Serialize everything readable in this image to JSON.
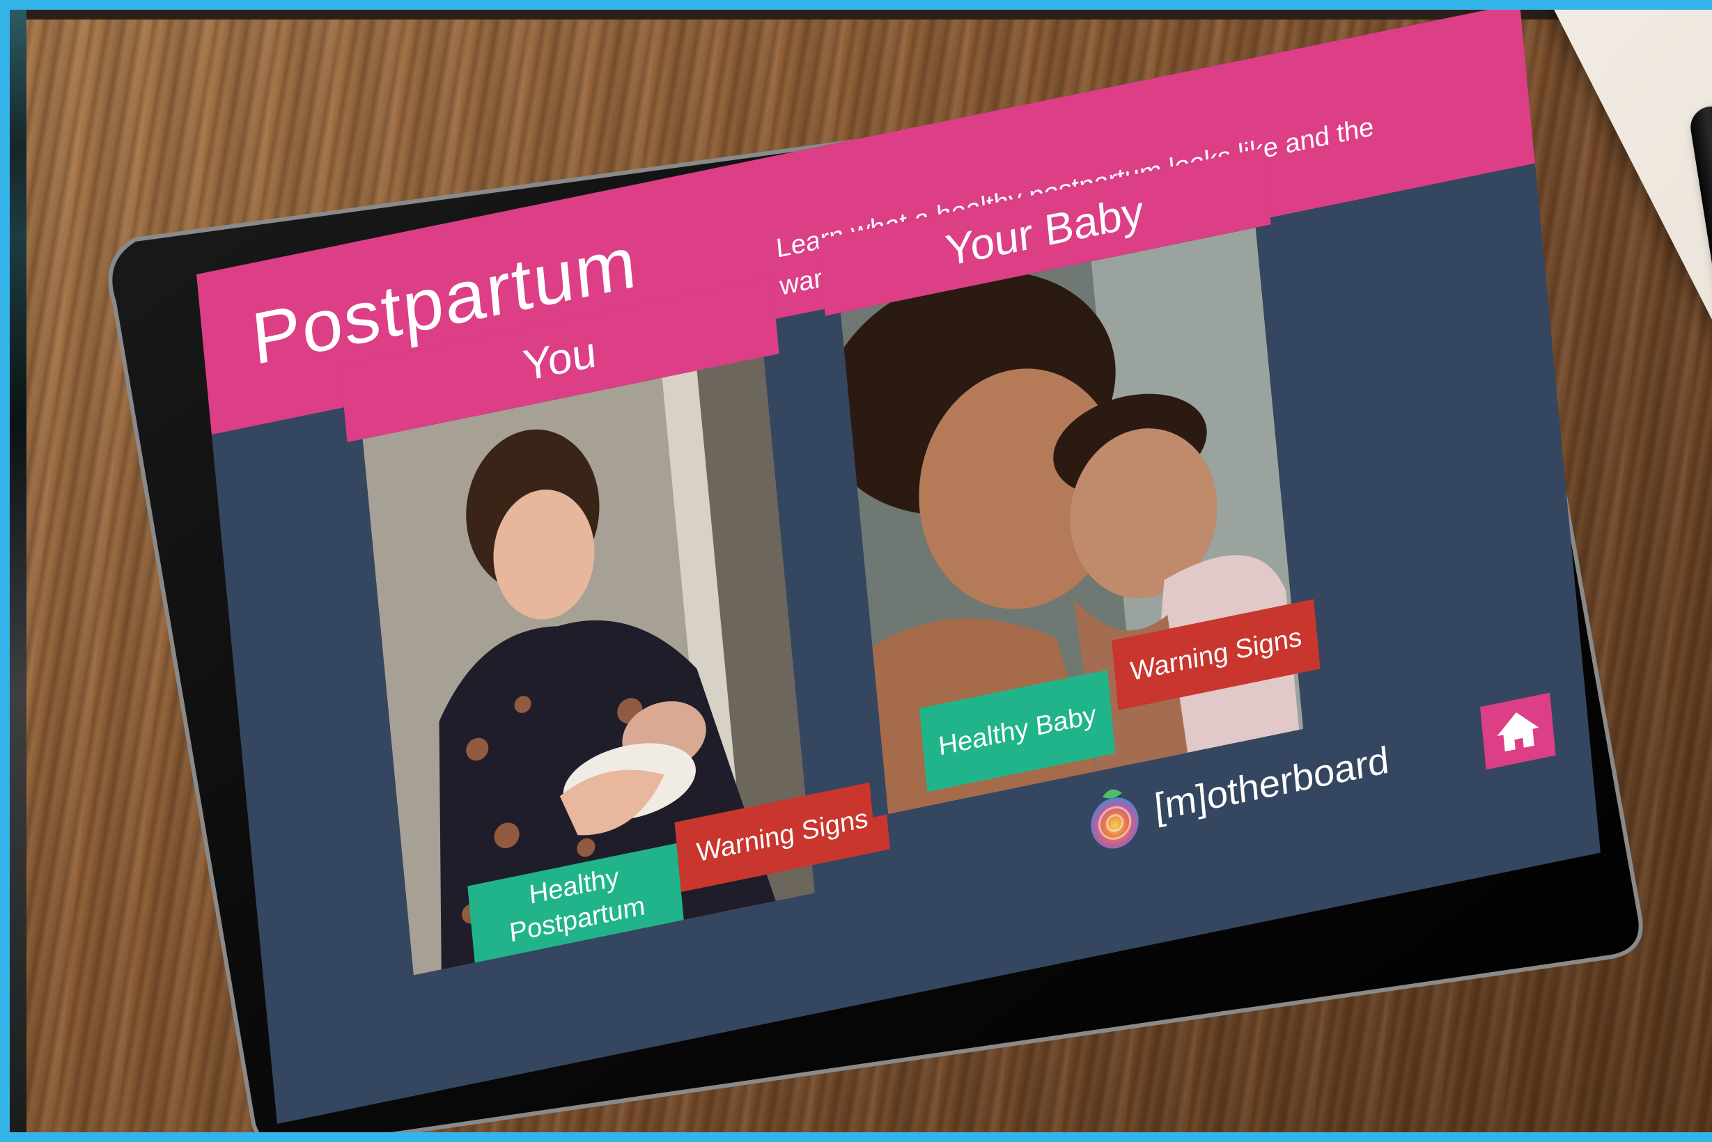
{
  "screen": {
    "title": "Postpartum",
    "subtitle": "Learn what a healthy postpartum looks like and the warning signs to watch for."
  },
  "panels": [
    {
      "heading": "You",
      "buttons": {
        "healthy": "Healthy Postpartum",
        "warning": "Warning Signs"
      }
    },
    {
      "heading": "Your Baby",
      "buttons": {
        "healthy": "Healthy Baby",
        "warning": "Warning Signs"
      }
    }
  ],
  "brand": {
    "name": "[m]otherboard"
  },
  "icons": {
    "home": "home-icon",
    "logo": "motherboard-logo"
  },
  "colors": {
    "accent_pink": "#dc3f86",
    "screen_bg": "#354660",
    "healthy_green": "#21b48a",
    "warning_red": "#c8362e"
  }
}
